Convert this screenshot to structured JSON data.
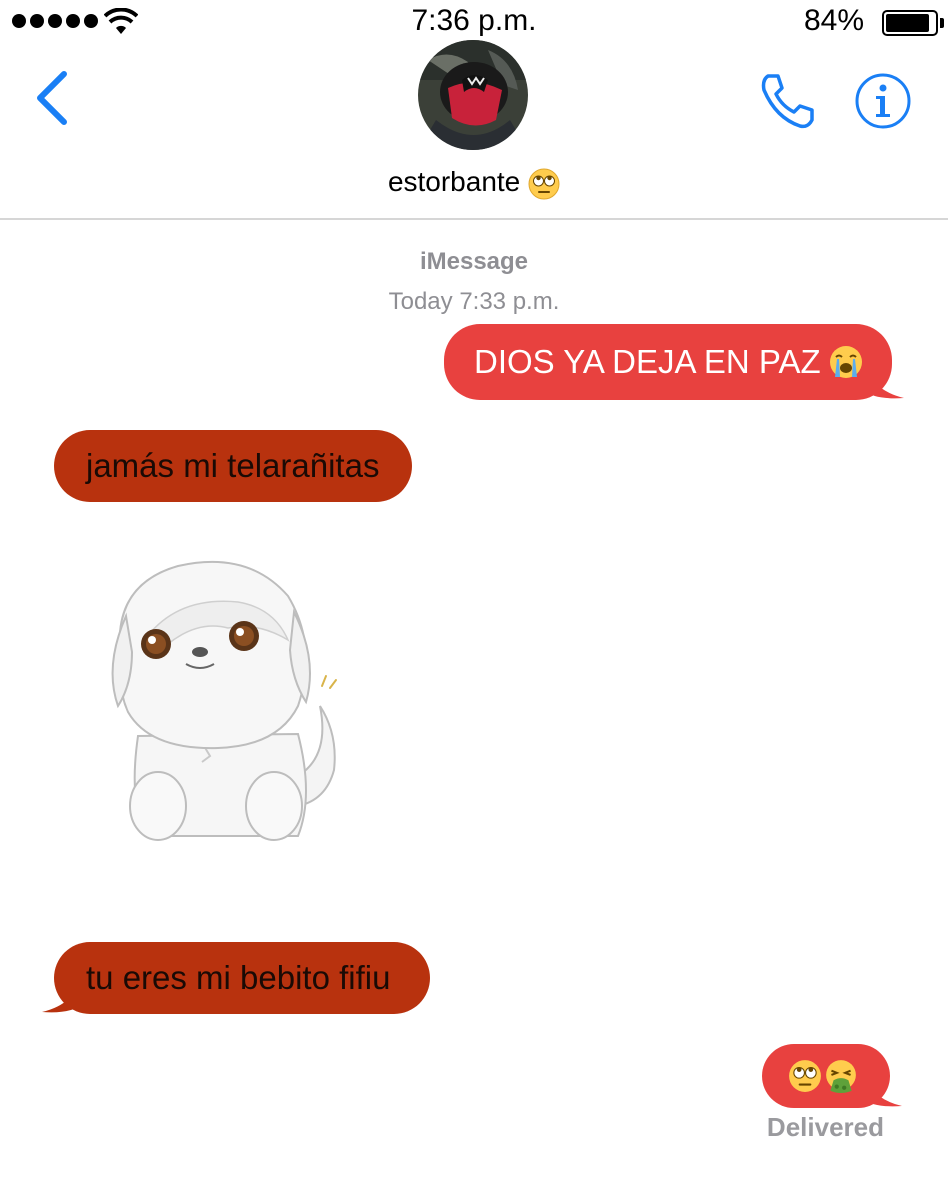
{
  "status_bar": {
    "time": "7:36 p.m.",
    "battery_percent": "84%",
    "battery_level": 0.84,
    "signal_bars": 5
  },
  "header": {
    "contact_name": "estorbante",
    "contact_emoji": "face-with-rolling-eyes",
    "back_icon": "chevron-left-icon",
    "call_icon": "phone-icon",
    "info_icon": "info-icon",
    "accent_color": "#1a7ff5"
  },
  "conversation": {
    "service": "iMessage",
    "timestamp": "Today 7:33 p.m.",
    "messages": [
      {
        "direction": "sent",
        "text": "DIOS YA DEJA EN PAZ",
        "emoji": "loudly-crying-face"
      },
      {
        "direction": "received",
        "text": "jamás mi telarañitas"
      },
      {
        "direction": "received",
        "sticker": "white-puppy-sticker"
      },
      {
        "direction": "received",
        "text": "tu eres mi bebito fifiu"
      },
      {
        "direction": "sent",
        "emojis": [
          "face-with-rolling-eyes",
          "face-vomiting"
        ]
      }
    ],
    "status": "Delivered"
  },
  "colors": {
    "sent_bubble": "#e8413f",
    "received_bubble": "#b8320e",
    "secondary_text": "#8e8e93"
  }
}
